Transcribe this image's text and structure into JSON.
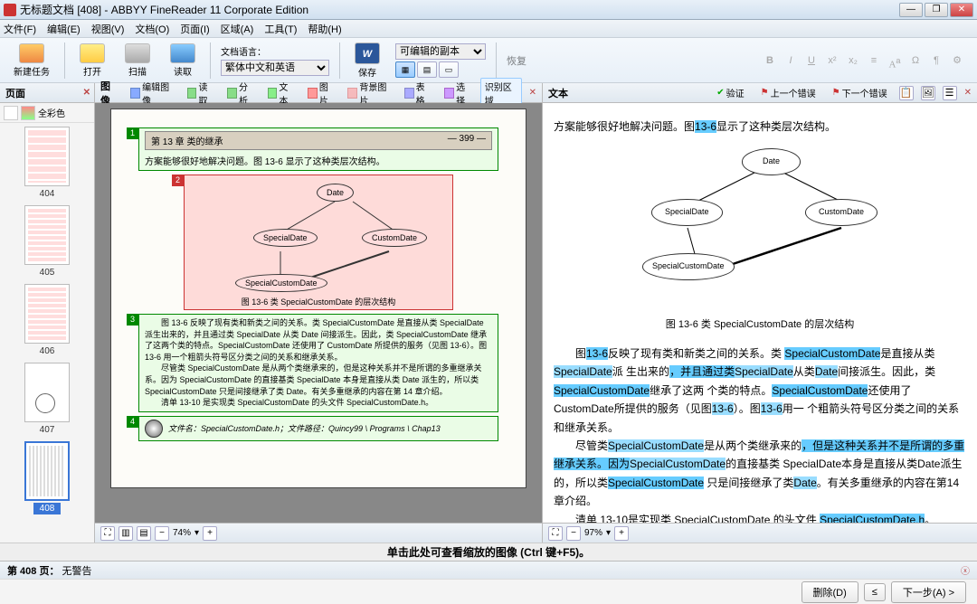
{
  "window": {
    "title": "无标题文档 [408] - ABBYY FineReader 11 Corporate Edition",
    "min": "—",
    "max": "❐",
    "close": "✕"
  },
  "menu": [
    "文件(F)",
    "编辑(E)",
    "视图(V)",
    "文档(O)",
    "页面(I)",
    "区域(A)",
    "工具(T)",
    "帮助(H)"
  ],
  "toolbar": {
    "new": "新建任务",
    "open": "打开",
    "scan": "扫描",
    "read": "读取",
    "lang_label": "文档语言：",
    "lang_value": "繁体中文和英语",
    "word": "W",
    "save": "保存",
    "layout_label": "可编辑的副本",
    "restore": "恢复"
  },
  "pages": {
    "title": "页面",
    "color_mode": "全彩色",
    "thumbs": [
      {
        "num": "404"
      },
      {
        "num": "405"
      },
      {
        "num": "406"
      },
      {
        "num": "407"
      },
      {
        "num": "408",
        "sel": true
      }
    ]
  },
  "image": {
    "title": "图像",
    "tools": {
      "edit": "编辑图像",
      "read": "读取",
      "analyze": "分析",
      "text": "文本",
      "pic": "图片",
      "bgpic": "背景图片",
      "table": "表格",
      "select": "选择",
      "recog": "识别区域"
    },
    "chapter_header_left": "第 13 章  类的继承",
    "chapter_header_right": "— 399 —",
    "line1": "方案能够很好地解决问题。图 13-6 显示了这种类层次结构。",
    "nodes": {
      "date": "Date",
      "sd": "SpecialDate",
      "cd": "CustomDate",
      "scd": "SpecialCustomDate"
    },
    "fig_caption": "图 13-6  类 SpecialCustomDate 的层次结构",
    "para2": "图 13-6 反映了现有类和新类之间的关系。类 SpecialCustomDate 是直接从类 SpecialDate 派生出来的，并且通过类 SpecialDate 从类 Date 间接派生。因此，类 SpecialCustomDate 继承了这两个类的特点。SpecialCustomDate 还使用了 CustomDate 所提供的服务（见图 13-6）。图 13-6 用一个粗箭头符号区分类之间的关系和继承关系。",
    "para3": "尽管类 SpecialCustomDate 是从两个类继承来的，但是这种关系并不是所谓的多重继承关系。因为 SpecialCustomDate 的直接基类 SpecialDate 本身是直接从类 Date 派生的，所以类 SpecialCustomDate 只是间接继承了类 Date。有关多重继承的内容在第 14 章介绍。",
    "para4": "清单 13-10 是实现类 SpecialCustomDate 的头文件 SpecialCustomDate.h。",
    "file_line": "文件名：SpecialCustomDate.h；文件路径：Quincy99 \\ Programs \\ Chap13",
    "zoom": "74%"
  },
  "text": {
    "title": "文本",
    "verify": "验证",
    "prev": "上一个错误",
    "next": "下一个错误",
    "line1_a": "方案能够很好地解决问题。图",
    "line1_b": "13-6",
    "line1_c": "显示了这种类层次结构。",
    "caption": "图 13-6  类 SpecialCustomDate 的层次结构",
    "p2_a": "图",
    "p2_b": "13-6",
    "p2_c": "反映了现有类和新类之间的关系。类",
    "p2_d": "SpecialCustomDate",
    "p2_e": "是直接从类",
    "p2_f": "SpecialDate",
    "p2_g": "派 生出来的",
    "p2_h": "，并且通过类",
    "p2_i": "SpecialDate",
    "p2_j": "从类",
    "p2_k": "Date",
    "p2_l": "间接派生。因此，类",
    "p2_m": "SpecialCustomDate",
    "p2_n": "继承了这两 个类的特点。",
    "p2_o": "SpecialCustomDate",
    "p2_p": "还使用了 CustomDate所提供的服务（见图",
    "p2_q": "13-6",
    "p2_r": "）。图",
    "p2_s": "13-6",
    "p2_t": "用一 个粗箭头符号区分类之间的关系和继承关系。",
    "p3_a": "尽管类",
    "p3_b": "SpecialCustomDate",
    "p3_c": "是从两个类继承来的",
    "p3_d": "，但是这种关系并不是所谓的多重继承关系。因为",
    "p3_e": "SpecialCustomDate",
    "p3_f": "的直接基类 SpecialDate本身是直接从类Date派生的，所以类",
    "p3_g": "SpecialCustomDate",
    "p3_h": " 只是间接继承了类",
    "p3_i": "Date",
    "p3_j": "。有关多重继承的内容在第14章介绍。",
    "p4_a": "清单 13-10是实现类 SpecialCustomDate 的头文件 ",
    "p4_b": "SpecialCustomDate.h",
    "p4_c": "。",
    "zoom": "97%"
  },
  "hint": "单击此处可查看缩放的图像 (Ctrl 键+F5)。",
  "status": {
    "page": "第 408 页：",
    "warn": "无警告"
  },
  "footer": {
    "delete": "删除(D)",
    "back": "≤",
    "next": "下一步(A) >"
  }
}
